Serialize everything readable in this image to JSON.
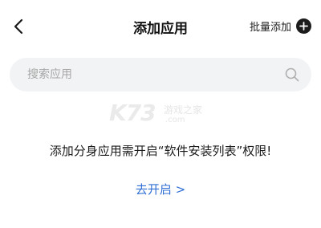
{
  "header": {
    "title": "添加应用",
    "batch_add_label": "批量添加"
  },
  "search": {
    "placeholder": "搜索应用",
    "value": ""
  },
  "watermark": {
    "logo": "K73",
    "subtitle": "游戏之家",
    "url": ".com"
  },
  "main": {
    "permission_message": "添加分身应用需开启“软件安装列表”权限!",
    "enable_link": "去开启 >"
  },
  "colors": {
    "link": "#2f6fd4",
    "search_bg": "#f2f3f5"
  },
  "icons": {
    "back": "back-arrow-icon",
    "add": "plus-circle-icon",
    "search": "search-icon"
  }
}
